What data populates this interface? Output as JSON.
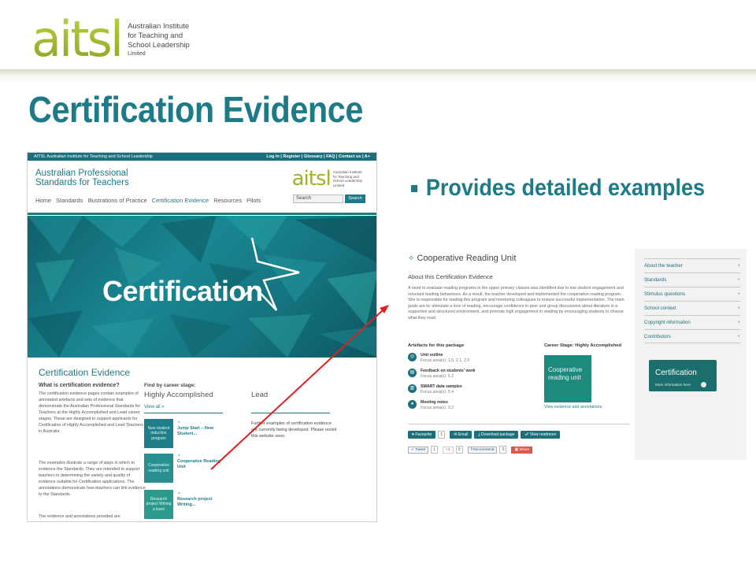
{
  "logo": {
    "word": "aitsl",
    "lines": [
      "Australian Institute",
      "for Teaching and",
      "School Leadership"
    ],
    "small": "Limited"
  },
  "slide": {
    "title": "Certification Evidence",
    "bullet": "Provides detailed examples"
  },
  "website": {
    "topbar_left": "AITSL Australian Institute for Teaching and School Leadership",
    "topbar_right": "Log in | Register | Glossary | FAQ | Contact us | A+",
    "site_name_line1": "Australian Professional",
    "site_name_line2": "Standards for Teachers",
    "site_logo_word": "aitsl",
    "site_logo_text": [
      "Australian Institute",
      "for Teaching and",
      "School Leadership",
      "Limited"
    ],
    "nav": [
      "Home",
      "Standards",
      "Illustrations of Practice",
      "Certification Evidence",
      "Resources",
      "Pilots"
    ],
    "search_placeholder": "Search",
    "search_button": "Search",
    "banner_word": "Certification",
    "body_title": "Certification Evidence",
    "what_is_heading": "What is certification evidence?",
    "para1": "The certification evidence pages contain examples of annotated artefacts and sets of evidence that demonstrate the Australian Professional Standards for Teachers at the Highly Accomplished and Lead career stages. These are designed to support applicants for Certification of Highly Accomplished and Lead Teachers in Australia.",
    "para2": "The examples illustrate a range of ways in which to evidence the Standards. They are intended to support teachers in determining the variety and quality of evidence suitable for Certification applications. The annotations demonstrate how teachers can link evidence to the Standards.",
    "para3": "The evidence and annotations provided are",
    "find_label": "Find by career stage:",
    "stage_ha": "Highly Accomplished",
    "stage_lead": "Lead",
    "view_all": "View all »",
    "lead_note": "Further examples of certification evidence are currently being developed. Please revisit this website soon.",
    "tiles": [
      {
        "tile_text": "New student induction program",
        "link": "Jump Start – New Student..."
      },
      {
        "tile_text": "Cooperative reading unit",
        "link": "Cooperative Reading Unit"
      },
      {
        "tile_text": "Research project Writing a learn",
        "link": "Research project Writing..."
      }
    ]
  },
  "detail": {
    "title": "Cooperative Reading Unit",
    "about_heading": "About this Certification Evidence",
    "description": "A need to evaluate reading programs in the upper primary classes was identified due to low student engagement and reluctant reading behaviours. As a result, the teacher developed and implemented the cooperative reading program. She is responsible for leading this program and mentoring colleagues to ensure successful implementation. The main goals are to: stimulate a love of reading, encourage confidence in peer and group discussions about literature in a supportive and structured environment, and promote high engagement in reading by encouraging students to choose what they read.",
    "artefacts_heading": "Artefacts for this package",
    "artefacts": [
      {
        "name": "Unit outline",
        "focus": "Focus area(s): 1.5, 2.1, 2.5"
      },
      {
        "name": "Feedback on students' work",
        "focus": "Focus area(s): 5.2"
      },
      {
        "name": "SMART data samples",
        "focus": "Focus area(s): 5.4"
      },
      {
        "name": "Meeting notes",
        "focus": "Focus area(s): 3.2"
      }
    ],
    "stage_heading": "Career Stage: Highly Accomplished",
    "tile_text": "Cooperative reading unit",
    "tile_link": "View evidence and annotations",
    "actions": {
      "favourite": "Favourite",
      "favourite_count": "1",
      "email": "Email",
      "download": "Download package",
      "view": "View readmore"
    },
    "social": {
      "tweet": "Tweet",
      "tweet_count": "1",
      "gplus": "+1",
      "gplus_count": "0",
      "facebook": "Recommend",
      "facebook_count": "0",
      "share": "Share"
    },
    "sidebar": [
      "About the teacher",
      "Standards",
      "Stimulus questions",
      "School context",
      "Copyright information",
      "Contributors"
    ],
    "badge_title": "Certification",
    "badge_sub": "More information here"
  },
  "colors": {
    "teal": "#1d7a87",
    "arrow": "#e02020",
    "logo_green": "#9ab52e"
  }
}
